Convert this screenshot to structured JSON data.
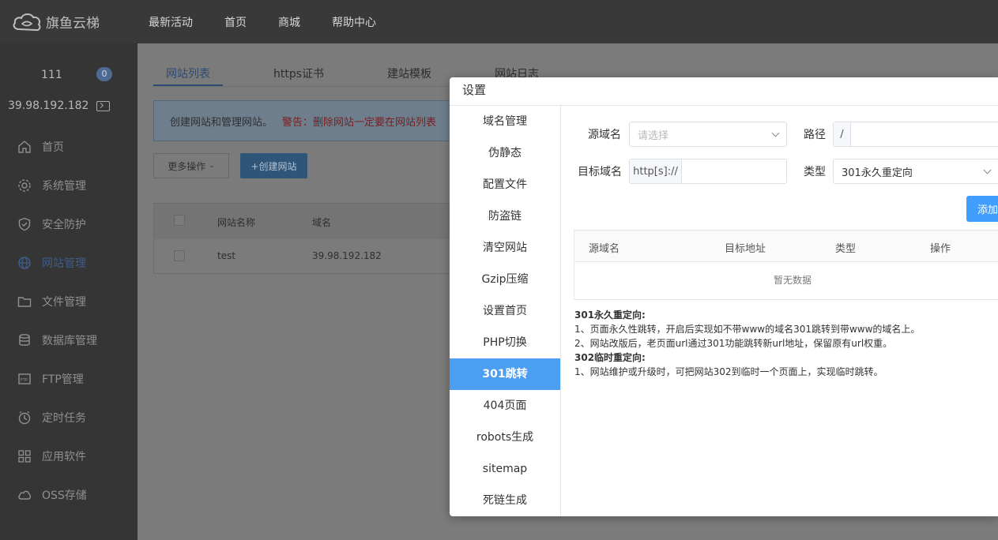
{
  "app": {
    "logo_text": "旗鱼云梯"
  },
  "topnav": [
    "最新活动",
    "首页",
    "商城",
    "帮助中心"
  ],
  "user": {
    "name": "111",
    "badge": "0",
    "ip": "39.98.192.182"
  },
  "sidebar": {
    "items": [
      {
        "label": "首页",
        "icon": "home-icon"
      },
      {
        "label": "系统管理",
        "icon": "gear-icon"
      },
      {
        "label": "安全防护",
        "icon": "shield-icon"
      },
      {
        "label": "网站管理",
        "icon": "globe-icon",
        "active": true
      },
      {
        "label": "文件管理",
        "icon": "folder-icon"
      },
      {
        "label": "数据库管理",
        "icon": "database-icon"
      },
      {
        "label": "FTP管理",
        "icon": "ftp-icon"
      },
      {
        "label": "定时任务",
        "icon": "clock-icon"
      },
      {
        "label": "应用软件",
        "icon": "apps-icon"
      },
      {
        "label": "OSS存储",
        "icon": "cloud-icon"
      }
    ]
  },
  "main": {
    "tabs": [
      "网站列表",
      "https证书",
      "建站模板",
      "网站日志"
    ],
    "info": "创建网站和管理网站。",
    "warning": "警告：删除网站一定要在网站列表",
    "more_btn": "更多操作",
    "create_btn": "+创建网站",
    "table": {
      "headers": [
        "网站名称",
        "域名"
      ],
      "rows": [
        [
          "test",
          "39.98.192.182"
        ]
      ]
    }
  },
  "modal": {
    "title": "设置",
    "side_items": [
      "域名管理",
      "伪静态",
      "配置文件",
      "防盗链",
      "清空网站",
      "Gzip压缩",
      "设置首页",
      "PHP切换",
      "301跳转",
      "404页面",
      "robots生成",
      "sitemap",
      "死链生成"
    ],
    "active_index": 8,
    "form": {
      "source_label": "源域名",
      "source_placeholder": "请选择",
      "path_label": "路径",
      "path_prefix": "/",
      "target_label": "目标域名",
      "target_prefix": "http[s]://",
      "type_label": "类型",
      "type_value": "301永久重定向",
      "add_btn": "添加"
    },
    "table": {
      "headers": [
        "源域名",
        "目标地址",
        "类型",
        "操作"
      ],
      "empty": "暂无数据"
    },
    "notes": {
      "h301": "301永久重定向:",
      "n1": "1、页面永久性跳转，开启后实现如不带www的域名301跳转到带www的域名上。",
      "n2": "2、网站改版后，老页面url通过301功能跳转新url地址，保留原有url权重。",
      "h302": "302临时重定向:",
      "n3": "1、网站维护或升级时，可把网站302到临时一个页面上，实现临时跳转。"
    }
  }
}
